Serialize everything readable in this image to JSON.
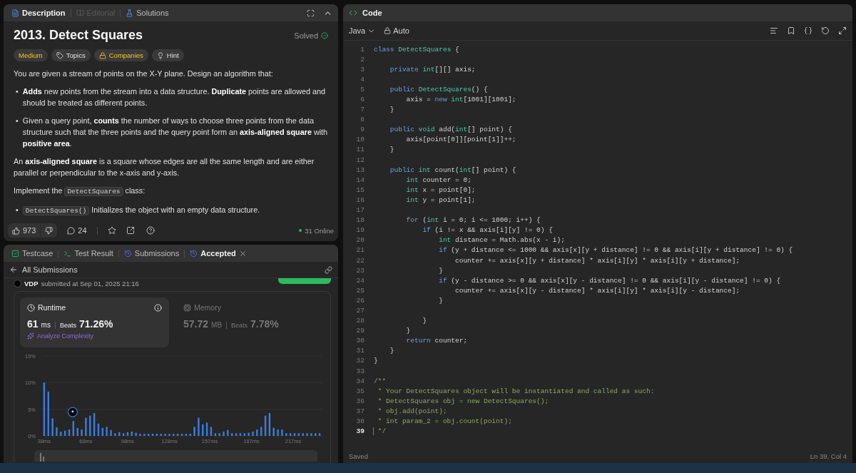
{
  "description_panel": {
    "tabs": [
      {
        "label": "Description",
        "selected": true,
        "disabled": false
      },
      {
        "label": "Editorial",
        "selected": false,
        "disabled": true
      },
      {
        "label": "Solutions",
        "selected": false,
        "disabled": false
      }
    ],
    "title": "2013. Detect Squares",
    "status": "Solved",
    "tags": [
      {
        "kind": "difficulty",
        "label": "Medium"
      },
      {
        "kind": "topics",
        "label": "Topics"
      },
      {
        "kind": "companies",
        "label": "Companies"
      },
      {
        "kind": "hint",
        "label": "Hint"
      }
    ],
    "blocks": [
      {
        "kind": "paragraph",
        "parts": [
          {
            "kind": "text",
            "text": "You are given a stream of points on the X-Y plane. Design an algorithm that:"
          }
        ]
      },
      {
        "kind": "bullet",
        "marker": "•",
        "parts": [
          {
            "kind": "text",
            "text": "**Adds** new points from the stream into a data structure. **Duplicate** points are allowed and should be treated as different points."
          }
        ]
      },
      {
        "kind": "bullet",
        "marker": "•",
        "parts": [
          {
            "kind": "text",
            "text": "Given a query point, **counts** the number of ways to choose three points from the data structure such that the three points and the query point form an **axis-aligned square** with **positive area**."
          }
        ]
      },
      {
        "kind": "paragraph",
        "parts": [
          {
            "kind": "text",
            "text": "An **axis-aligned square** is a square whose edges are all the same length and are either parallel or perpendicular to the x-axis and y-axis."
          }
        ]
      },
      {
        "kind": "paragraph",
        "parts": [
          {
            "kind": "text",
            "text": "Implement the "
          },
          {
            "kind": "code",
            "text": "DetectSquares"
          },
          {
            "kind": "text",
            "text": " class:"
          }
        ]
      },
      {
        "kind": "bullet",
        "marker": "•",
        "parts": [
          {
            "kind": "code",
            "text": "DetectSquares()"
          },
          {
            "kind": "text",
            "text": " Initializes the object with an empty data structure."
          }
        ]
      }
    ],
    "likes": "973",
    "comments": "24",
    "online": "31 Online"
  },
  "result_panel": {
    "tabs": [
      {
        "label": "Testcase",
        "selected": false,
        "closable": false
      },
      {
        "label": "Test Result",
        "selected": false,
        "closable": false
      },
      {
        "label": "Submissions",
        "selected": false,
        "closable": false
      },
      {
        "label": "Accepted",
        "selected": true,
        "closable": true
      }
    ],
    "back_label": "All Submissions",
    "user": "VDP",
    "submitted": "submitted at Sep 01, 2025 21:16",
    "stats": [
      {
        "kind": "runtime",
        "label": "Runtime",
        "value": "61",
        "unit": "ms",
        "beats_label": "Beats",
        "beats": "71.26%",
        "selected": true,
        "action": "Analyze Complexity"
      },
      {
        "kind": "memory",
        "label": "Memory",
        "value": "57.72",
        "unit": "MB",
        "beats_label": "Beats",
        "beats": "7.78%",
        "selected": false
      }
    ],
    "chart_data": {
      "type": "bar",
      "x": [
        38,
        41,
        44,
        47,
        50,
        53,
        56,
        59,
        62,
        65,
        68,
        71,
        74,
        77,
        80,
        83,
        86,
        89,
        92,
        95,
        98,
        101,
        104,
        107,
        110,
        113,
        116,
        119,
        122,
        125,
        128,
        131,
        134,
        137,
        140,
        143,
        146,
        149,
        152,
        155,
        158,
        161,
        164,
        167,
        170,
        173,
        176,
        179,
        182,
        185,
        188,
        191,
        194,
        197,
        200,
        203,
        206,
        209,
        212,
        215,
        218,
        221,
        224,
        227,
        230,
        233,
        236
      ],
      "values": [
        10,
        8.3,
        3.3,
        1.6,
        0.8,
        1,
        1.2,
        2.8,
        1.5,
        1.2,
        3.4,
        3.8,
        4.3,
        2.3,
        1.5,
        1.7,
        1.1,
        0.5,
        0.7,
        0.5,
        0.7,
        0.8,
        0.6,
        0.4,
        0.4,
        0.4,
        0.4,
        0.4,
        0.4,
        0.4,
        0.4,
        0.4,
        0.4,
        0.4,
        0.4,
        0.4,
        1.7,
        3.4,
        2.2,
        2.5,
        1.7,
        0.5,
        0.5,
        0.8,
        1.1,
        0.5,
        0.5,
        0.5,
        0.5,
        0.6,
        0.8,
        1.2,
        1.7,
        3.8,
        4.3,
        1.5,
        1.2,
        1.2,
        0.5,
        0.5,
        0.5,
        0.5,
        0.5,
        0.5,
        0.5,
        0.5,
        0.5
      ],
      "xlim": [
        36,
        238
      ],
      "ylim": [
        0,
        15
      ],
      "yticks": [
        {
          "value": 0,
          "label": "0%"
        },
        {
          "value": 5,
          "label": "5%"
        },
        {
          "value": 10,
          "label": "10%"
        },
        {
          "value": 15,
          "label": "15%"
        }
      ],
      "xticks": [
        {
          "value": 38,
          "label": "38ms"
        },
        {
          "value": 68,
          "label": "68ms"
        },
        {
          "value": 98,
          "label": "98ms"
        },
        {
          "value": 128,
          "label": "128ms"
        },
        {
          "value": 157,
          "label": "157ms"
        },
        {
          "value": 187,
          "label": "187ms"
        },
        {
          "value": 217,
          "label": "217ms"
        }
      ]
    }
  },
  "code_panel": {
    "title": "Code",
    "language": "Java",
    "mode": "Auto",
    "lines": [
      {
        "number": "1",
        "active": false,
        "segments": [
          {
            "kind": "keyword",
            "text": "class"
          },
          {
            "kind": "type",
            "text": " DetectSquares"
          },
          {
            "kind": "plain",
            "text": " {"
          }
        ]
      },
      {
        "number": "2",
        "active": false
      },
      {
        "number": "3",
        "active": false,
        "segments": [
          {
            "kind": "keyword",
            "text": "    private"
          },
          {
            "kind": "type",
            "text": " int"
          },
          {
            "kind": "plain",
            "text": "[][] axis;"
          }
        ]
      },
      {
        "number": "4",
        "active": false
      },
      {
        "number": "5",
        "active": false,
        "segments": [
          {
            "kind": "keyword",
            "text": "    public"
          },
          {
            "kind": "type",
            "text": " DetectSquares"
          },
          {
            "kind": "plain",
            "text": "() {"
          }
        ]
      },
      {
        "number": "6",
        "active": false,
        "segments": [
          {
            "kind": "plain",
            "text": "        axis = "
          },
          {
            "kind": "keyword",
            "text": "new"
          },
          {
            "kind": "type",
            "text": " int"
          },
          {
            "kind": "plain",
            "text": "[1001][1001];"
          }
        ]
      },
      {
        "number": "7",
        "active": false,
        "segments": [
          {
            "kind": "plain",
            "text": "    }"
          }
        ]
      },
      {
        "number": "8",
        "active": false
      },
      {
        "number": "9",
        "active": false,
        "segments": [
          {
            "kind": "keyword",
            "text": "    public"
          },
          {
            "kind": "type",
            "text": " void"
          },
          {
            "kind": "plain",
            "text": " add("
          },
          {
            "kind": "type",
            "text": "int"
          },
          {
            "kind": "plain",
            "text": "[] point) {"
          }
        ]
      },
      {
        "number": "10",
        "active": false,
        "segments": [
          {
            "kind": "plain",
            "text": "        axis[point[0]][point[1]]++;"
          }
        ]
      },
      {
        "number": "11",
        "active": false,
        "segments": [
          {
            "kind": "plain",
            "text": "    }"
          }
        ]
      },
      {
        "number": "12",
        "active": false
      },
      {
        "number": "13",
        "active": false,
        "segments": [
          {
            "kind": "keyword",
            "text": "    public"
          },
          {
            "kind": "type",
            "text": " int"
          },
          {
            "kind": "plain",
            "text": " count("
          },
          {
            "kind": "type",
            "text": "int"
          },
          {
            "kind": "plain",
            "text": "[] point) {"
          }
        ]
      },
      {
        "number": "14",
        "active": false,
        "segments": [
          {
            "kind": "type",
            "text": "        int"
          },
          {
            "kind": "plain",
            "text": " counter = 0;"
          }
        ]
      },
      {
        "number": "15",
        "active": false,
        "segments": [
          {
            "kind": "type",
            "text": "        int"
          },
          {
            "kind": "plain",
            "text": " x = point[0];"
          }
        ]
      },
      {
        "number": "16",
        "active": false,
        "segments": [
          {
            "kind": "type",
            "text": "        int"
          },
          {
            "kind": "plain",
            "text": " y = point[1];"
          }
        ]
      },
      {
        "number": "17",
        "active": false
      },
      {
        "number": "18",
        "active": false,
        "segments": [
          {
            "kind": "keyword",
            "text": "        for"
          },
          {
            "kind": "plain",
            "text": " ("
          },
          {
            "kind": "type",
            "text": "int"
          },
          {
            "kind": "plain",
            "text": " i = 0; i <= 1000; i++) {"
          }
        ]
      },
      {
        "number": "19",
        "active": false,
        "segments": [
          {
            "kind": "keyword",
            "text": "            if"
          },
          {
            "kind": "plain",
            "text": " (i != x && axis[i][y] != 0) {"
          }
        ]
      },
      {
        "number": "20",
        "active": false,
        "segments": [
          {
            "kind": "type",
            "text": "                int"
          },
          {
            "kind": "plain",
            "text": " distance = Math.abs(x - i);"
          }
        ]
      },
      {
        "number": "21",
        "active": false,
        "segments": [
          {
            "kind": "keyword",
            "text": "                if"
          },
          {
            "kind": "plain",
            "text": " (y + distance <= 1000 && axis[x][y + distance] != 0 && axis[i][y + distance] != 0) {"
          }
        ]
      },
      {
        "number": "22",
        "active": false,
        "segments": [
          {
            "kind": "plain",
            "text": "                    counter += axis[x][y + distance] * axis[i][y] * axis[i][y + distance];"
          }
        ]
      },
      {
        "number": "23",
        "active": false,
        "segments": [
          {
            "kind": "plain",
            "text": "                }"
          }
        ]
      },
      {
        "number": "24",
        "active": false,
        "segments": [
          {
            "kind": "keyword",
            "text": "                if"
          },
          {
            "kind": "plain",
            "text": " (y - distance >= 0 && axis[x][y - distance] != 0 && axis[i][y - distance] != 0) {"
          }
        ]
      },
      {
        "number": "25",
        "active": false,
        "segments": [
          {
            "kind": "plain",
            "text": "                    counter += axis[x][y - distance] * axis[i][y] * axis[i][y - distance];"
          }
        ]
      },
      {
        "number": "26",
        "active": false,
        "segments": [
          {
            "kind": "plain",
            "text": "                }"
          }
        ]
      },
      {
        "number": "27",
        "active": false
      },
      {
        "number": "28",
        "active": false,
        "segments": [
          {
            "kind": "plain",
            "text": "            }"
          }
        ]
      },
      {
        "number": "29",
        "active": false,
        "segments": [
          {
            "kind": "plain",
            "text": "        }"
          }
        ]
      },
      {
        "number": "30",
        "active": false,
        "segments": [
          {
            "kind": "keyword",
            "text": "        return"
          },
          {
            "kind": "plain",
            "text": " counter;"
          }
        ]
      },
      {
        "number": "31",
        "active": false,
        "segments": [
          {
            "kind": "plain",
            "text": "    }"
          }
        ]
      },
      {
        "number": "32",
        "active": false,
        "segments": [
          {
            "kind": "plain",
            "text": "}"
          }
        ]
      },
      {
        "number": "33",
        "active": false
      },
      {
        "number": "34",
        "active": false,
        "segments": [
          {
            "kind": "comment",
            "text": "/**"
          }
        ]
      },
      {
        "number": "35",
        "active": false,
        "segments": [
          {
            "kind": "comment",
            "text": " * Your DetectSquares object will be instantiated and called as such:"
          }
        ]
      },
      {
        "number": "36",
        "active": false,
        "segments": [
          {
            "kind": "comment",
            "text": " * DetectSquares obj = new DetectSquares();"
          }
        ]
      },
      {
        "number": "37",
        "active": false,
        "segments": [
          {
            "kind": "comment",
            "text": " * obj.add(point);"
          }
        ]
      },
      {
        "number": "38",
        "active": false,
        "segments": [
          {
            "kind": "comment",
            "text": " * int param_2 = obj.count(point);"
          }
        ]
      },
      {
        "number": "39",
        "active": true,
        "segments": [
          {
            "kind": "comment",
            "text": " */"
          }
        ]
      }
    ],
    "save_status": "Saved",
    "cursor": "Ln 39, Col 4"
  }
}
